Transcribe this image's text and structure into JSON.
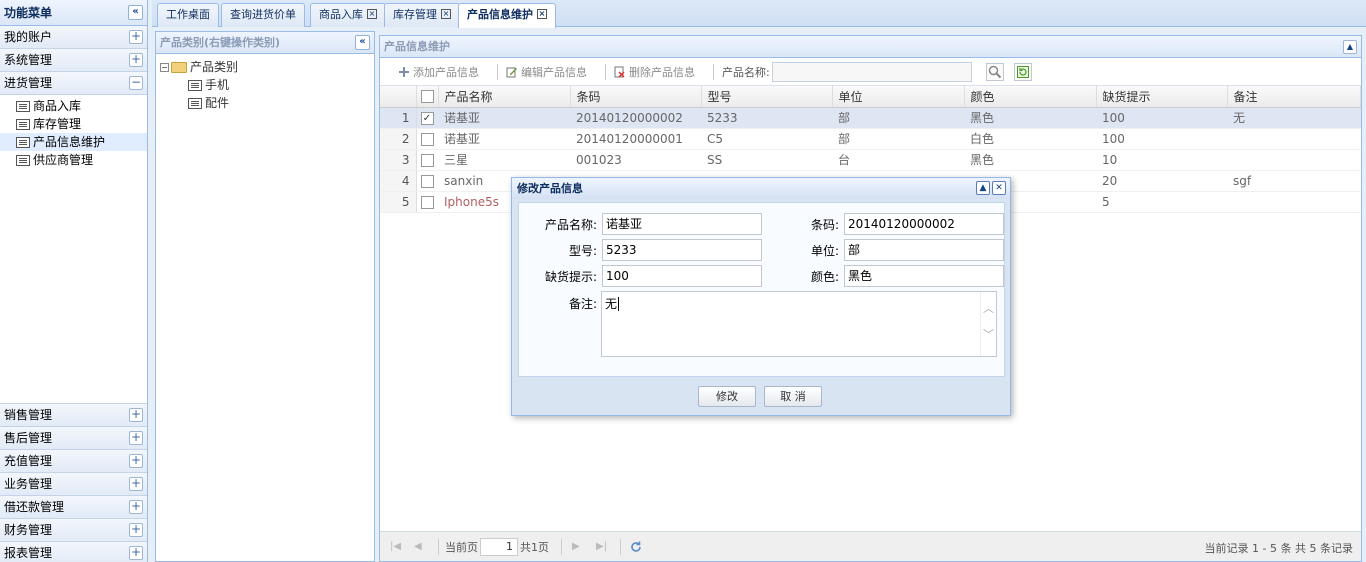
{
  "leftmenu": {
    "title": "功能菜单",
    "sections_top": [
      "我的账户",
      "系统管理"
    ],
    "active_section": "进货管理",
    "items": [
      "商品入库",
      "库存管理",
      "产品信息维护",
      "供应商管理"
    ],
    "sections_bottom": [
      "销售管理",
      "售后管理",
      "充值管理",
      "业务管理",
      "借还款管理",
      "财务管理",
      "报表管理"
    ]
  },
  "tabs": [
    {
      "label": "工作桌面"
    },
    {
      "label": "查询进货价单"
    },
    {
      "label": "商品入库"
    },
    {
      "label": "库存管理"
    },
    {
      "label": "产品信息维护"
    }
  ],
  "category": {
    "header": "产品类别(右键操作类别)",
    "root": "产品类别",
    "children": [
      "手机",
      "配件"
    ]
  },
  "main": {
    "header": "产品信息维护",
    "toolbar": {
      "add": "添加产品信息",
      "edit": "编辑产品信息",
      "delete": "删除产品信息",
      "search_label": "产品名称:"
    },
    "columns": [
      "产品名称",
      "条码",
      "型号",
      "单位",
      "颜色",
      "缺货提示",
      "备注"
    ],
    "rows": [
      {
        "n": "1",
        "checked": "✓",
        "name": "诺基亚",
        "code": "20140120000002",
        "model": "5233",
        "unit": "部",
        "color": "黑色",
        "stock": "100",
        "note": "无"
      },
      {
        "n": "2",
        "checked": "",
        "name": "诺基亚",
        "code": "20140120000001",
        "model": "C5",
        "unit": "部",
        "color": "白色",
        "stock": "100",
        "note": ""
      },
      {
        "n": "3",
        "checked": "",
        "name": "三星",
        "code": "001023",
        "model": "SS",
        "unit": "台",
        "color": "黑色",
        "stock": "10",
        "note": ""
      },
      {
        "n": "4",
        "checked": "",
        "name": "sanxin",
        "code": "",
        "model": "",
        "unit": "",
        "color": "",
        "stock": "20",
        "note": "sgf"
      },
      {
        "n": "5",
        "checked": "",
        "name": "Iphone5s",
        "code": "",
        "model": "",
        "unit": "",
        "color": "",
        "stock": "5",
        "note": ""
      }
    ],
    "pager": {
      "current_label": "当前页",
      "page_value": "1",
      "total_label": "共1页",
      "summary": "当前记录 1 - 5 条 共 5 条记录"
    }
  },
  "dialog": {
    "title": "修改产品信息",
    "fields": {
      "name_label": "产品名称:",
      "name_value": "诺基亚",
      "code_label": "条码:",
      "code_value": "20140120000002",
      "model_label": "型号:",
      "model_value": "5233",
      "unit_label": "单位:",
      "unit_value": "部",
      "stock_label": "缺货提示:",
      "stock_value": "100",
      "color_label": "颜色:",
      "color_value": "黑色",
      "note_label": "备注:",
      "note_value": "无"
    },
    "ok_label": "修改",
    "cancel_label": "取 消"
  }
}
